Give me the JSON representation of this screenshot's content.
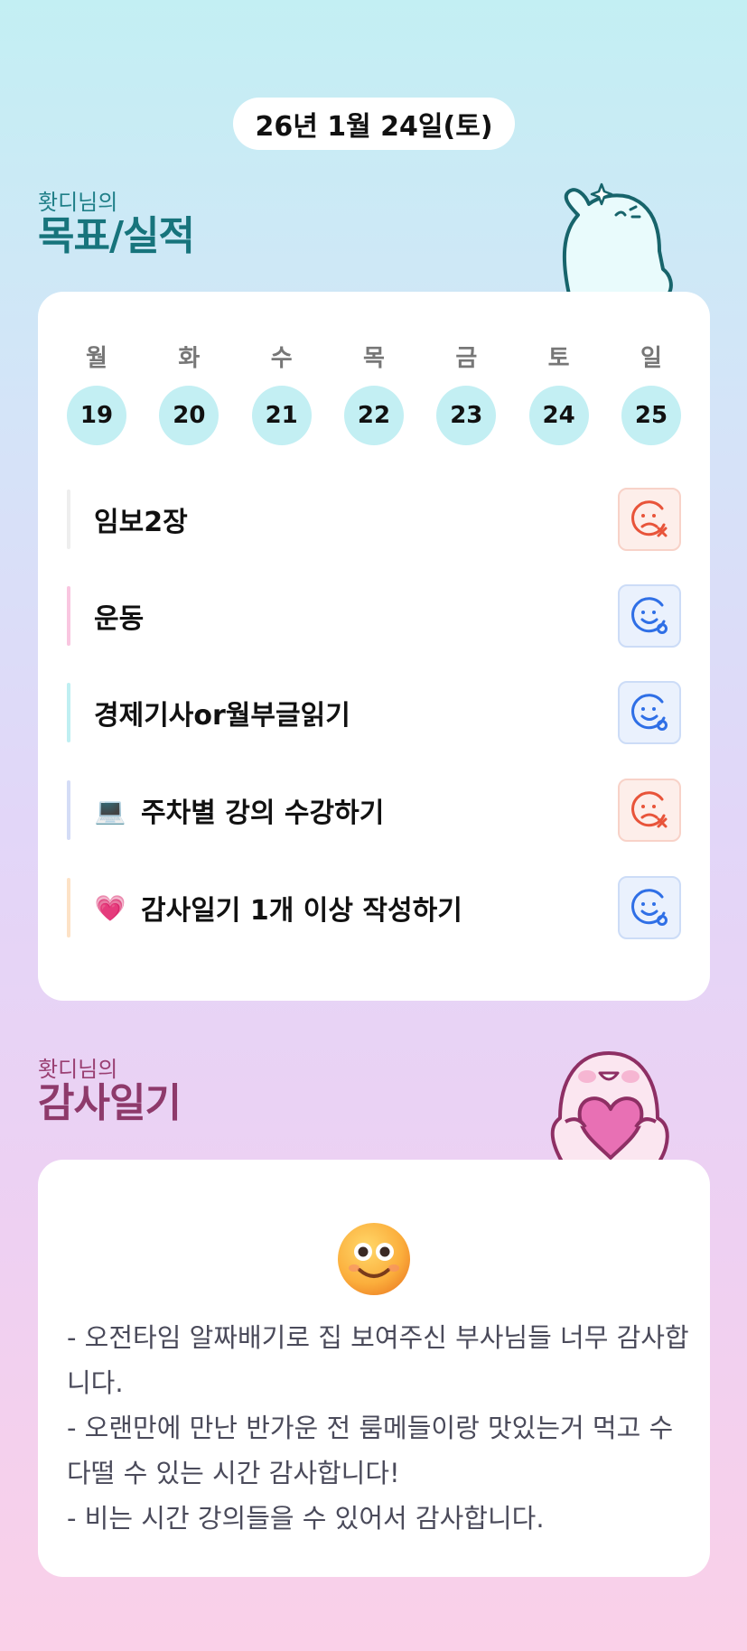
{
  "date": "26년 1월 24일(토)",
  "goals_section": {
    "sub_title": "홧디님의",
    "main_title": "목표/실적"
  },
  "week": [
    {
      "name": "월",
      "num": "19"
    },
    {
      "name": "화",
      "num": "20"
    },
    {
      "name": "수",
      "num": "21"
    },
    {
      "name": "목",
      "num": "22"
    },
    {
      "name": "금",
      "num": "23"
    },
    {
      "name": "토",
      "num": "24"
    },
    {
      "name": "일",
      "num": "25"
    }
  ],
  "goals": [
    {
      "text": "임보2장",
      "emoji": "",
      "bar_color": "#eeeeee",
      "status": "fail"
    },
    {
      "text": "운동",
      "emoji": "",
      "bar_color": "#f9c6e0",
      "status": "done"
    },
    {
      "text": "경제기사or월부글읽기",
      "emoji": "",
      "bar_color": "#bfeff2",
      "status": "done"
    },
    {
      "text": "주차별 강의 수강하기",
      "emoji": "💻",
      "bar_color": "#d4dcf6",
      "status": "fail"
    },
    {
      "text": "감사일기 1개 이상 작성하기",
      "emoji": "💗",
      "bar_color": "#fde2c6",
      "status": "done"
    }
  ],
  "status_icons": {
    "fail": "sad-face-x-icon",
    "done": "smile-face-o-icon"
  },
  "colors": {
    "fail": "#e8543a",
    "done": "#2f6fe6",
    "goals_title": "#17747c",
    "diary_title": "#8e3a6b"
  },
  "diary_section": {
    "sub_title": "홧디님의",
    "main_title": "감사일기"
  },
  "diary": {
    "emoji": "smiling-face-emoji",
    "lines": [
      "- 오전타임 알짜배기로 집 보여주신 부사님들 너무 감사합니다.",
      "- 오랜만에 만난 반가운 전 룸메들이랑 맛있는거 먹고 수다떨 수 있는 시간 감사합니다!",
      "- 비는 시간 강의들을 수 있어서 감사합니다."
    ]
  }
}
